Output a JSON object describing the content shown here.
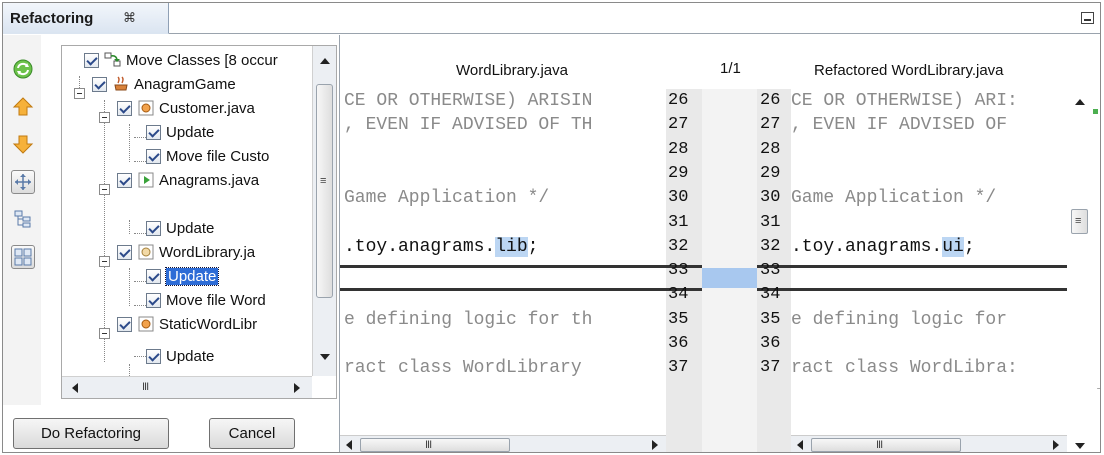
{
  "window": {
    "tab_title": "Refactoring",
    "tab_close": "⌘"
  },
  "tree": {
    "root": "Move Classes [8 occur",
    "project": "AnagramGame",
    "items": [
      {
        "label": "Customer.java"
      },
      {
        "label": "Update"
      },
      {
        "label": "Move file Custo"
      },
      {
        "label": "Anagrams.java"
      },
      {
        "label": "Update"
      },
      {
        "label": "WordLibrary.ja"
      },
      {
        "label": "Update"
      },
      {
        "label": "Move file Word"
      },
      {
        "label": "StaticWordLibr"
      },
      {
        "label": "Update"
      }
    ],
    "hscroll_grip": "III"
  },
  "buttons": {
    "do_refactoring": "Do Refactoring",
    "cancel": "Cancel"
  },
  "diff": {
    "left_title": "WordLibrary.java",
    "counter": "1/1",
    "right_title": "Refactored WordLibrary.java",
    "rows": [
      {
        "num": "26",
        "left": "CE OR OTHERWISE) ARISIN",
        "right": "CE OR OTHERWISE) ARI:"
      },
      {
        "num": "27",
        "left": ", EVEN IF ADVISED OF TH",
        "right": ", EVEN IF ADVISED OF"
      },
      {
        "num": "28",
        "left": "",
        "right": ""
      },
      {
        "num": "29",
        "left": "",
        "right": ""
      },
      {
        "num": "30",
        "left": "Game Application */",
        "right": "Game Application */"
      },
      {
        "num": "31",
        "left": "",
        "right": ""
      },
      {
        "num": "32",
        "left_pre": ".toy.anagrams.",
        "left_hl": "lib",
        "left_post": ";",
        "right_pre": ".toy.anagrams.",
        "right_hl": "ui",
        "right_post": ";"
      },
      {
        "num": "33",
        "left": "",
        "right": ""
      },
      {
        "num": "34",
        "left": "",
        "right": ""
      },
      {
        "num": "35",
        "left": "e defining logic for th",
        "right": "e defining logic for"
      },
      {
        "num": "36",
        "left": "",
        "right": ""
      },
      {
        "num": "37",
        "left": "ract class WordLibrary",
        "right": "ract class WordLibra:"
      }
    ],
    "hscroll_grip": "III"
  },
  "colors": {
    "change_highlight": "#bcd6f3",
    "change_marker": "#a8c8ef",
    "selection": "#2d6cd6"
  },
  "icons": [
    "refresh-icon",
    "previous-occurrence-icon",
    "next-occurrence-icon",
    "expand-all-icon",
    "logical-view-icon",
    "physical-view-icon"
  ]
}
